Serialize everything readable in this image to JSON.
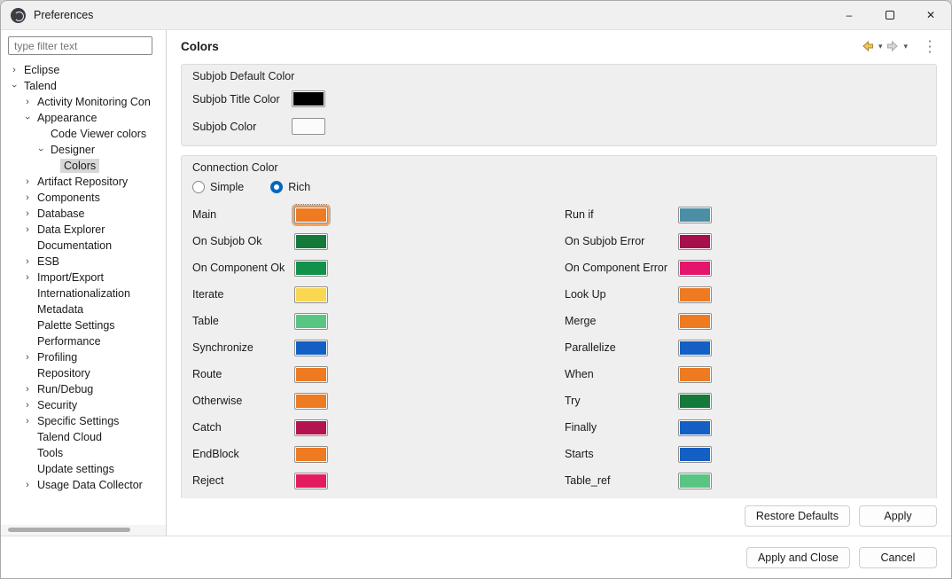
{
  "theme": {
    "accent": "#0067C0",
    "focus_ring": "#F5A35B"
  },
  "window": {
    "title": "Preferences"
  },
  "sidebar": {
    "filter_placeholder": "type filter text",
    "tree": [
      {
        "label": "Eclipse",
        "arrow": "right",
        "indent": 0
      },
      {
        "label": "Talend",
        "arrow": "down",
        "indent": 0
      },
      {
        "label": "Activity Monitoring Con",
        "arrow": "right",
        "indent": 1
      },
      {
        "label": "Appearance",
        "arrow": "down",
        "indent": 1
      },
      {
        "label": "Code Viewer colors",
        "arrow": "none",
        "indent": 2
      },
      {
        "label": "Designer",
        "arrow": "down",
        "indent": 2
      },
      {
        "label": "Colors",
        "arrow": "none",
        "indent": 3,
        "selected": true
      },
      {
        "label": "Artifact Repository",
        "arrow": "right",
        "indent": 1
      },
      {
        "label": "Components",
        "arrow": "right",
        "indent": 1
      },
      {
        "label": "Database",
        "arrow": "right",
        "indent": 1
      },
      {
        "label": "Data Explorer",
        "arrow": "right",
        "indent": 1
      },
      {
        "label": "Documentation",
        "arrow": "none",
        "indent": 1
      },
      {
        "label": "ESB",
        "arrow": "right",
        "indent": 1
      },
      {
        "label": "Import/Export",
        "arrow": "right",
        "indent": 1
      },
      {
        "label": "Internationalization",
        "arrow": "none",
        "indent": 1
      },
      {
        "label": "Metadata",
        "arrow": "none",
        "indent": 1
      },
      {
        "label": "Palette Settings",
        "arrow": "none",
        "indent": 1
      },
      {
        "label": "Performance",
        "arrow": "none",
        "indent": 1
      },
      {
        "label": "Profiling",
        "arrow": "right",
        "indent": 1
      },
      {
        "label": "Repository",
        "arrow": "none",
        "indent": 1
      },
      {
        "label": "Run/Debug",
        "arrow": "right",
        "indent": 1
      },
      {
        "label": "Security",
        "arrow": "right",
        "indent": 1
      },
      {
        "label": "Specific Settings",
        "arrow": "right",
        "indent": 1
      },
      {
        "label": "Talend Cloud",
        "arrow": "none",
        "indent": 1
      },
      {
        "label": "Tools",
        "arrow": "none",
        "indent": 1
      },
      {
        "label": "Update settings",
        "arrow": "none",
        "indent": 1
      },
      {
        "label": "Usage Data Collector",
        "arrow": "right",
        "indent": 1
      }
    ]
  },
  "main": {
    "page_title": "Colors",
    "groups": {
      "subjob": {
        "title": "Subjob Default Color",
        "rows": [
          {
            "label": "Subjob Title Color",
            "color": "#000000"
          },
          {
            "label": "Subjob Color",
            "color": "#FBFBFB"
          }
        ]
      },
      "connection": {
        "title": "Connection Color",
        "options": [
          {
            "label": "Simple",
            "selected": false
          },
          {
            "label": "Rich",
            "selected": true
          }
        ],
        "left_rows": [
          {
            "label": "Main",
            "color": "#EE7A22",
            "focused": true
          },
          {
            "label": "On Subjob Ok",
            "color": "#147A3C"
          },
          {
            "label": "On Component Ok",
            "color": "#12914B"
          },
          {
            "label": "Iterate",
            "color": "#FAD750"
          },
          {
            "label": "Table",
            "color": "#59C583"
          },
          {
            "label": "Synchronize",
            "color": "#145FC4"
          },
          {
            "label": "Route",
            "color": "#EE7A22"
          },
          {
            "label": "Otherwise",
            "color": "#EE7A22"
          },
          {
            "label": "Catch",
            "color": "#B3134F"
          },
          {
            "label": "EndBlock",
            "color": "#EE7A22"
          },
          {
            "label": "Reject",
            "color": "#E31C5F"
          }
        ],
        "right_rows": [
          {
            "label": "Run if",
            "color": "#4A8FA6"
          },
          {
            "label": "On Subjob Error",
            "color": "#A60E4C"
          },
          {
            "label": "On Component Error",
            "color": "#E5156C"
          },
          {
            "label": "Look Up",
            "color": "#EE7A22"
          },
          {
            "label": "Merge",
            "color": "#EE7A22"
          },
          {
            "label": "Parallelize",
            "color": "#145FC4"
          },
          {
            "label": "When",
            "color": "#EE7A22"
          },
          {
            "label": "Try",
            "color": "#147A3C"
          },
          {
            "label": "Finally",
            "color": "#145FC4"
          },
          {
            "label": "Starts",
            "color": "#145FC4"
          },
          {
            "label": "Table_ref",
            "color": "#59C583"
          }
        ]
      }
    },
    "actions": {
      "restore_defaults": "Restore Defaults",
      "apply": "Apply"
    }
  },
  "footer": {
    "apply_and_close": "Apply and Close",
    "cancel": "Cancel"
  }
}
